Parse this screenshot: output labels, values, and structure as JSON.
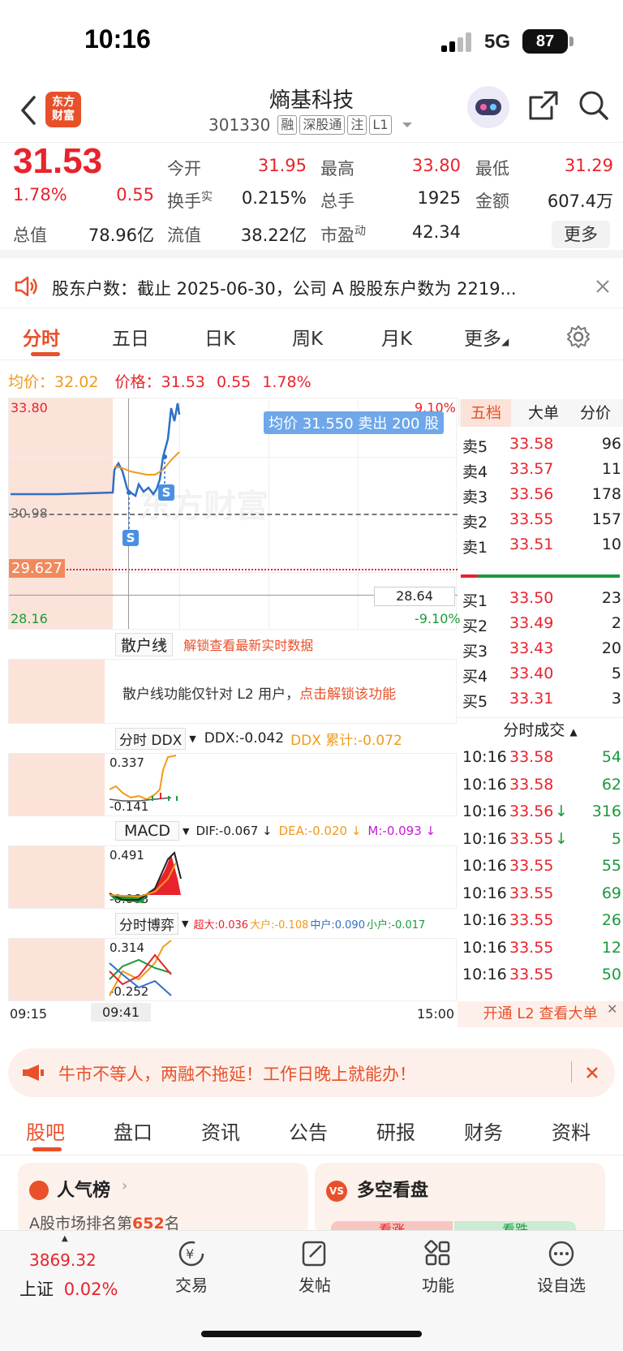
{
  "status_bar": {
    "time": "10:16",
    "network": "5G",
    "battery": "87"
  },
  "header": {
    "logo_line1": "东方",
    "logo_line2": "财富",
    "stock_name": "熵基科技",
    "stock_code": "301330",
    "tags": [
      "融",
      "深股通",
      "注",
      "L1"
    ]
  },
  "quote": {
    "price": "31.53",
    "change_pct": "1.78%",
    "change": "0.55",
    "fields": {
      "open_label": "今开",
      "open": "31.95",
      "high_label": "最高",
      "high": "33.80",
      "low_label": "最低",
      "low": "31.29",
      "turnover_label": "换手",
      "turnover_sup": "实",
      "turnover": "0.215%",
      "volume_label": "总手",
      "volume": "1925",
      "amount_label": "金额",
      "amount": "607.4万",
      "mktcap_label": "总值",
      "mktcap": "78.96亿",
      "float_label": "流值",
      "float": "38.22亿",
      "pe_label": "市盈",
      "pe_sup": "动",
      "pe": "42.34"
    },
    "more_label": "更多"
  },
  "notice": {
    "text": "股东户数：截止 2025-06-30，公司 A 股股东户数为 2219..."
  },
  "chart_tabs": [
    "分时",
    "五日",
    "日K",
    "周K",
    "月K",
    "更多"
  ],
  "active_chart_tab": "分时",
  "info_line": {
    "avg_label": "均价：",
    "avg": "32.02",
    "price_label": "价格：",
    "price": "31.53",
    "change": "0.55",
    "change_pct": "1.78%"
  },
  "chart_labels": {
    "top_price": "33.80",
    "top_pct": "9.10%",
    "mid_price": "30.98",
    "current_price_tag": "29.627",
    "bottom_price": "28.16",
    "crosshair_price": "28.64",
    "bottom_pct": "-9.10%",
    "watermark": "东方财富",
    "tooltip": "均价 31.550  卖出 200 股",
    "time_start": "09:15",
    "time_cursor": "09:41",
    "time_end": "15:00",
    "marker": "S"
  },
  "indicators": {
    "retail_line": {
      "label": "散户线",
      "lock_text": "解锁查看最新实时数据",
      "desc": "散户线功能仅针对 L2 用户，",
      "unlock": "点击解锁该功能"
    },
    "ddx": {
      "label": "分时 DDX",
      "ddx": "DDX:-0.042",
      "ddx_sum": "DDX 累计:-0.072",
      "top": "0.337",
      "bottom": "-0.141"
    },
    "macd": {
      "label": "MACD",
      "dif": "DIF:-0.067 ↓",
      "dea": "DEA:-0.020 ↓",
      "m": "M:-0.093 ↓",
      "top": "0.491",
      "bottom": "-0.063"
    },
    "game": {
      "label": "分时博弈",
      "super": "超大:0.036",
      "large": "大户:-0.108",
      "mid": "中户:0.090",
      "small": "小户:-0.017",
      "top": "0.314",
      "bottom": "-0.252"
    }
  },
  "book_tabs": [
    "五档",
    "大单",
    "分价"
  ],
  "asks": [
    {
      "label": "卖5",
      "price": "33.58",
      "vol": "96"
    },
    {
      "label": "卖4",
      "price": "33.57",
      "vol": "11"
    },
    {
      "label": "卖3",
      "price": "33.56",
      "vol": "178"
    },
    {
      "label": "卖2",
      "price": "33.55",
      "vol": "157"
    },
    {
      "label": "卖1",
      "price": "33.51",
      "vol": "10"
    }
  ],
  "bids": [
    {
      "label": "买1",
      "price": "33.50",
      "vol": "23"
    },
    {
      "label": "买2",
      "price": "33.49",
      "vol": "2"
    },
    {
      "label": "买3",
      "price": "33.43",
      "vol": "20"
    },
    {
      "label": "买4",
      "price": "33.40",
      "vol": "5"
    },
    {
      "label": "买5",
      "price": "33.31",
      "vol": "3"
    }
  ],
  "trades_title": "分时成交",
  "trades": [
    {
      "time": "10:16",
      "price": "33.58",
      "vol": "54",
      "arrow": ""
    },
    {
      "time": "10:16",
      "price": "33.58",
      "vol": "62",
      "arrow": ""
    },
    {
      "time": "10:16",
      "price": "33.56",
      "vol": "316",
      "arrow": "↓"
    },
    {
      "time": "10:16",
      "price": "33.55",
      "vol": "5",
      "arrow": "↓"
    },
    {
      "time": "10:16",
      "price": "33.55",
      "vol": "55",
      "arrow": ""
    },
    {
      "time": "10:16",
      "price": "33.55",
      "vol": "69",
      "arrow": ""
    },
    {
      "time": "10:16",
      "price": "33.55",
      "vol": "26",
      "arrow": ""
    },
    {
      "time": "10:16",
      "price": "33.55",
      "vol": "12",
      "arrow": ""
    },
    {
      "time": "10:16",
      "price": "33.55",
      "vol": "50",
      "arrow": ""
    }
  ],
  "l2_link": "开通 L2 查看大单",
  "banner": {
    "text": "牛市不等人，两融不拖延！工作日晚上就能办！"
  },
  "content_tabs": [
    "股吧",
    "盘口",
    "资讯",
    "公告",
    "研报",
    "财务",
    "资料"
  ],
  "cards": {
    "popularity": {
      "title": "人气榜",
      "rank_prefix": "A股市场排名第",
      "rank": "652",
      "rank_suffix": "名"
    },
    "bullbear": {
      "title": "多空看盘",
      "bull": "看涨",
      "bear": "看跌"
    }
  },
  "bottom_nav": {
    "index_value": "3869.32",
    "index_name": "上证",
    "index_change": "0.02%",
    "items": [
      "交易",
      "发帖",
      "功能",
      "设自选"
    ]
  },
  "colors": {
    "up": "#e8232c",
    "down": "#1a9a3c",
    "accent": "#e8502a",
    "avg_line": "#f09a1b",
    "price_line": "#2f6fc6"
  }
}
